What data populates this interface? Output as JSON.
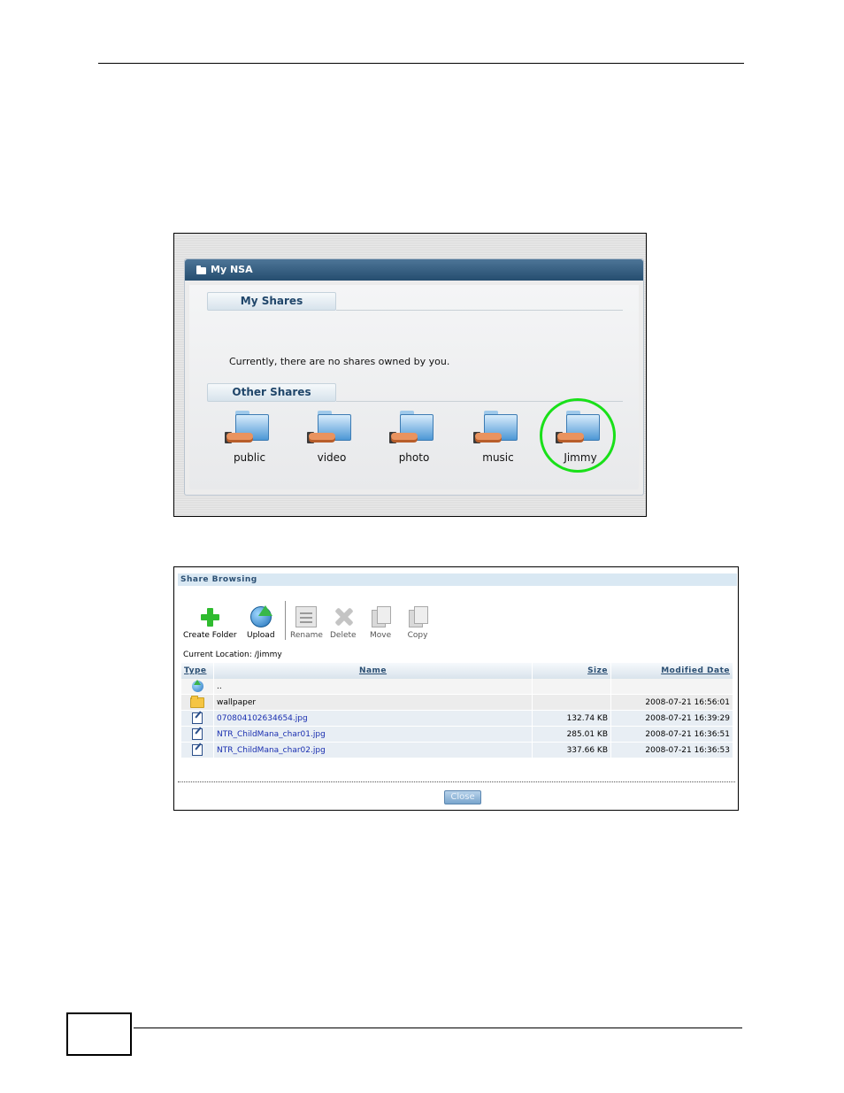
{
  "my_nsa": {
    "title": "My NSA",
    "my_shares_tab": "My Shares",
    "no_shares_message": "Currently, there are no shares owned by you.",
    "other_shares_tab": "Other Shares",
    "shares": [
      "public",
      "video",
      "photo",
      "music",
      "Jimmy"
    ],
    "highlight_color": "#19e019"
  },
  "share_browsing": {
    "title": "Share Browsing",
    "toolbar": {
      "create_folder": "Create Folder",
      "upload": "Upload",
      "rename": "Rename",
      "delete": "Delete",
      "move": "Move",
      "copy": "Copy"
    },
    "current_location": "Current Location: /Jimmy",
    "columns": {
      "type": "Type",
      "name": "Name",
      "size": "Size",
      "modified_date": "Modified Date"
    },
    "rows": [
      {
        "icon": "parent-folder-icon",
        "name": "..",
        "size": "",
        "date": ""
      },
      {
        "icon": "folder-icon",
        "name": "wallpaper",
        "size": "",
        "date": "2008-07-21 16:56:01"
      },
      {
        "icon": "file-icon",
        "name": "070804102634654.jpg",
        "size": "132.74 KB",
        "date": "2008-07-21 16:39:29"
      },
      {
        "icon": "file-icon",
        "name": "NTR_ChildMana_char01.jpg",
        "size": "285.01 KB",
        "date": "2008-07-21 16:36:51"
      },
      {
        "icon": "file-icon",
        "name": "NTR_ChildMana_char02.jpg",
        "size": "337.66 KB",
        "date": "2008-07-21 16:36:53"
      }
    ],
    "close_label": "Close"
  }
}
